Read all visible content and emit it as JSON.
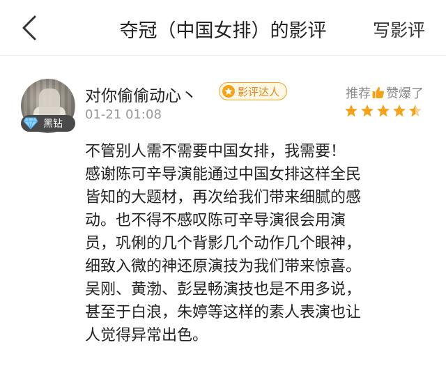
{
  "header": {
    "title": "夺冠（中国女排）的影评",
    "write_label": "写影评"
  },
  "review": {
    "username": "对你偷偷动心丶",
    "avatar_badge": "黑钻",
    "talent_badge": "影评达人",
    "timestamp": "01-21 01:08",
    "recommend_prefix": "推荐",
    "recommend_suffix": "赞爆了",
    "rating_stars": 4.5,
    "rating_max": 5,
    "accent_color": "#f3a31b",
    "lines": [
      "不管别人需不需要中国女排，我需要！",
      "感谢陈可辛导演能通过中国女排这样全民",
      "皆知的大题材，再次给我们带来细腻的感",
      "动。也不得不感叹陈可辛导演很会用演",
      "员，巩俐的几个背影几个动作几个眼神，",
      "细致入微的神还原演技为我们带来惊喜。",
      "吴刚、黄渤、彭昱畅演技也是不用多说，",
      "甚至于白浪，朱婷等这样的素人表演也让",
      "人觉得异常出色。"
    ]
  }
}
